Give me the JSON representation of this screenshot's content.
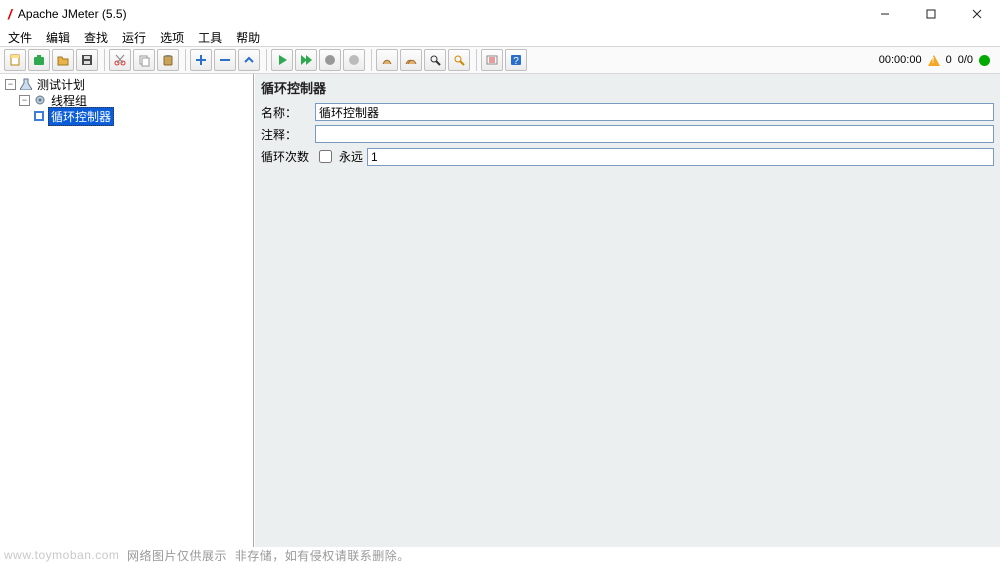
{
  "window": {
    "title": "Apache JMeter (5.5)"
  },
  "menu": {
    "items": [
      "文件",
      "编辑",
      "查找",
      "运行",
      "选项",
      "工具",
      "帮助"
    ]
  },
  "toolbar": {
    "icons": [
      "new-file-icon",
      "templates-icon",
      "open-icon",
      "save-icon",
      "cut-icon",
      "copy-icon",
      "paste-icon",
      "expand-icon",
      "collapse-icon",
      "toggle-icon",
      "start-icon",
      "start-no-pause-icon",
      "stop-icon",
      "shutdown-icon",
      "clear-icon",
      "clear-all-icon",
      "search-icon",
      "reset-search-icon",
      "function-helper-icon",
      "help-icon"
    ]
  },
  "status": {
    "time": "00:00:00",
    "threads_active": "0",
    "threads_total": "0/0"
  },
  "tree": {
    "root": {
      "label": "测试计划",
      "expanded": true
    },
    "group": {
      "label": "线程组",
      "expanded": true
    },
    "selected": {
      "label": "循环控制器"
    }
  },
  "editor": {
    "title": "循环控制器",
    "name_label": "名称：",
    "name_value": "循环控制器",
    "comment_label": "注释：",
    "comment_value": "",
    "loop_label": "循环次数",
    "forever_label": "永远",
    "forever_checked": false,
    "loop_value": "1"
  },
  "watermark": {
    "site": "www.toymoban.com",
    "note1": "网络图片仅供展示",
    "note2": "非存储，如有侵权请联系删除。"
  }
}
